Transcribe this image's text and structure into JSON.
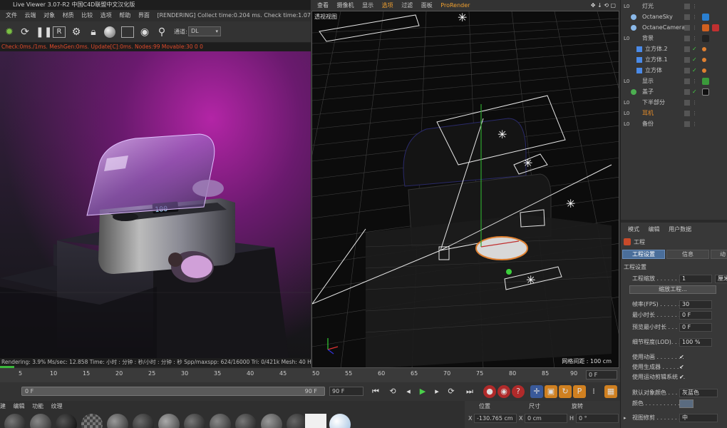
{
  "live_viewer": {
    "title": "Live Viewer 3.07-R2 中国C4D联盟中文汉化版",
    "menu": [
      "文件",
      "云端",
      "对象",
      "材质",
      "比较",
      "选项",
      "帮助",
      "界面"
    ],
    "render_status": "[RENDERING] Collect time:0.204 ms.  Check time:1.076 m",
    "channel_label": "通道:",
    "channel_value": "DL",
    "stats_line": "Check:0ms./1ms. MeshGen:0ms. Update[C]:0ms. Nodes:99 Movable:30  0 0",
    "bottom_status": "Rendering: 3.9%    Ms/sec: 12.858   Time: 小时 : 分钟 : 秒/小时 : 分钟 : 秒   Spp/maxspp: 624/16000  Tri: 0/421k    Mesh: 40   Hair"
  },
  "viewport": {
    "menu": [
      "查看",
      "摄像机",
      "显示",
      "选项",
      "过滤",
      "面板",
      "ProRender"
    ],
    "active_menu": "选项",
    "label": "透视视图",
    "grid_label": "网格间距 : 100 cm"
  },
  "object_manager": {
    "rows": [
      {
        "name": "灯光",
        "indent": 0,
        "kind": "null",
        "color": "#c8c8c8"
      },
      {
        "name": "OctaneSky",
        "indent": 1,
        "kind": "obj",
        "color": "#c8c8c8"
      },
      {
        "name": "OctaneCamera",
        "indent": 1,
        "kind": "obj",
        "color": "#c8c8c8"
      },
      {
        "name": "背景",
        "indent": 0,
        "kind": "null",
        "color": "#c8c8c8"
      },
      {
        "name": "立方体.2",
        "indent": 2,
        "kind": "cube",
        "color": "#c8c8c8"
      },
      {
        "name": "立方体.1",
        "indent": 2,
        "kind": "cube",
        "color": "#c8c8c8"
      },
      {
        "name": "立方体",
        "indent": 2,
        "kind": "cube",
        "color": "#c8c8c8"
      },
      {
        "name": "显示",
        "indent": 0,
        "kind": "null",
        "color": "#c8c8c8"
      },
      {
        "name": "盖子",
        "indent": 0,
        "kind": "green",
        "color": "#c8c8c8"
      },
      {
        "name": "下半部分",
        "indent": 0,
        "kind": "null",
        "color": "#c8c8c8"
      },
      {
        "name": "耳机",
        "indent": 0,
        "kind": "null",
        "color": "#e08a2a"
      },
      {
        "name": "备份",
        "indent": 0,
        "kind": "null",
        "color": "#c8c8c8"
      }
    ]
  },
  "attribute_manager": {
    "tabs": [
      "模式",
      "编辑",
      "用户数据"
    ],
    "object_label": "工程",
    "sub_tabs": [
      "工程设置",
      "信息",
      "动"
    ],
    "section": "工程设置",
    "rows": [
      {
        "label": "工程缩放 . . . . . . . .",
        "value": "1",
        "extra": "厘米"
      },
      {
        "label": "",
        "button": "缩放工程..."
      },
      {
        "label": "帧率(FPS) . . . . . . .",
        "value": "30"
      },
      {
        "label": "最小时长 . . . . . . . .",
        "value": "0 F"
      },
      {
        "label": "预览最小时长 . . . . .",
        "value": "0 F"
      },
      {
        "label": "细节程度(LOD). . . . .",
        "value": "100 %"
      },
      {
        "label": "使用动画 . . . . . . . .",
        "check": "✔"
      },
      {
        "label": "使用生成器 . . . . . .",
        "check": "✔"
      },
      {
        "label": "使用运动剪辑系统 . .",
        "check": "✔"
      },
      {
        "label": "默认对象颜色 . . . .",
        "value": "灰蓝色"
      },
      {
        "label": "颜色 . . . . . . . . . . . .",
        "swatch": "#5a6b80"
      },
      {
        "label": "视图修剪 . . . . . . . .",
        "value": "中"
      }
    ]
  },
  "timeline": {
    "ticks": [
      "5",
      "10",
      "15",
      "20",
      "25",
      "30",
      "35",
      "40",
      "45",
      "50",
      "55",
      "60",
      "65",
      "70",
      "75",
      "80",
      "85",
      "90"
    ],
    "current_frame": "0 F",
    "range_start": "0 F",
    "range_end": "90 F",
    "range_end_field": "90 F"
  },
  "materials": {
    "menu": [
      "建",
      "编辑",
      "功能",
      "纹理"
    ]
  },
  "coordinates": {
    "headers": [
      "位置",
      "尺寸",
      "旋转"
    ],
    "x_label": "X",
    "x_pos": "-130.765 cm",
    "x_size_label": "X",
    "x_size": "0 cm",
    "h_label": "H",
    "h_rot": "0 °"
  }
}
